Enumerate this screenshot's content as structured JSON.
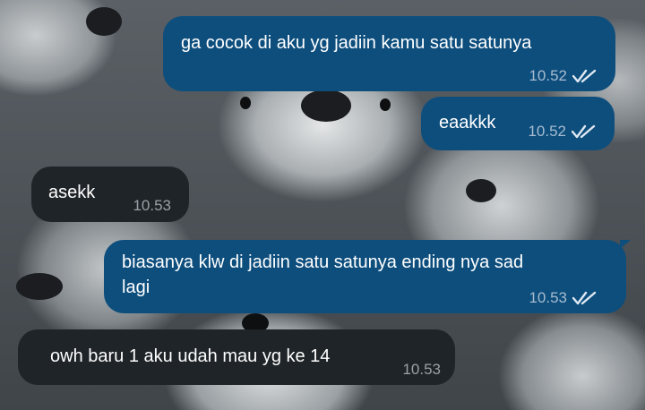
{
  "messages": [
    {
      "direction": "outgoing",
      "text": "ga cocok di aku yg jadiin kamu satu satunya",
      "time": "10.52",
      "status": "double-check-icon"
    },
    {
      "direction": "outgoing",
      "text": "eaakkk",
      "time": "10.52",
      "status": "double-check-icon"
    },
    {
      "direction": "incoming",
      "text": "asekk",
      "time": "10.53"
    },
    {
      "direction": "outgoing",
      "lines": [
        "biasanya klw di jadiin satu satunya ending nya sad",
        "lagi"
      ],
      "time": "10.53",
      "status": "double-check-icon"
    },
    {
      "direction": "incoming",
      "text": "owh baru 1 aku udah mau yg ke 14",
      "time": "10.53"
    }
  ],
  "colors": {
    "outgoing_bubble": "#0d4e7d",
    "incoming_bubble": "#1f2428",
    "text": "#ffffff",
    "outgoing_meta": "#a7bcd0",
    "incoming_meta": "#9aa0a6"
  }
}
